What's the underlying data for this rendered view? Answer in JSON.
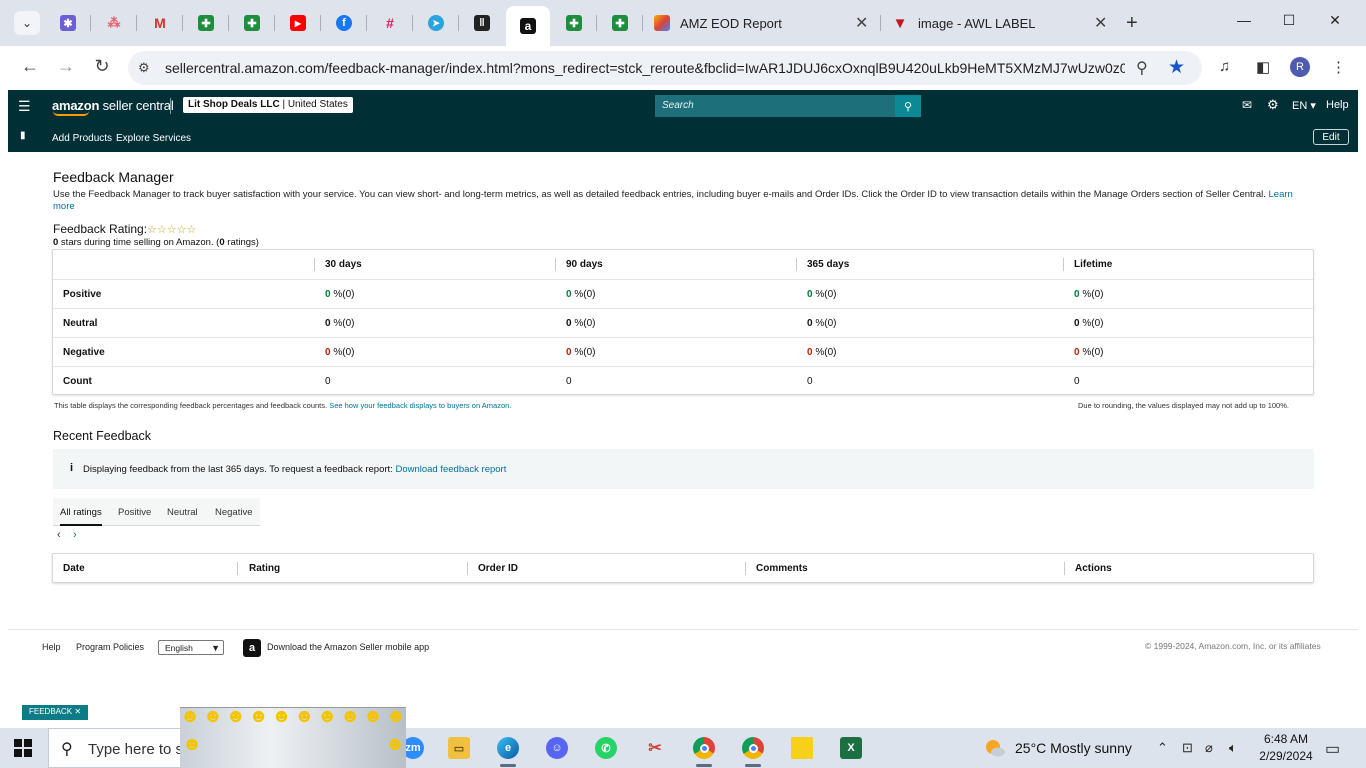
{
  "browser": {
    "tabs": [
      {
        "name": "amz-eod-report",
        "title": "AMZ EOD Report"
      },
      {
        "name": "awl-label",
        "title": "image - AWL LABEL"
      }
    ],
    "url_host": "sellercentral.amazon.com",
    "url_path": "/feedback-manager/index.html?mons_redirect=stck_reroute&fbclid=IwAR1JDUJ6cxOxnqlB9U420uLkb9HeMT5XMzMJ7wUzw0z0...",
    "profile_initial": "R"
  },
  "sc_header": {
    "logo_text_bold": "amazon",
    "logo_text": " seller central",
    "store_name": "Lit Shop Deals LLC",
    "store_region": " | United States",
    "search_placeholder": "Search",
    "language": "EN",
    "help": "Help"
  },
  "subnav": {
    "add_products": "Add Products",
    "explore_services": "Explore Services",
    "edit": "Edit"
  },
  "page": {
    "title": "Feedback Manager",
    "description": "Use the Feedback Manager to track buyer satisfaction with your service. You can view short- and long-term metrics, as well as detailed feedback entries, including buyer e-mails and Order IDs. Click the Order ID to view transaction details within the Manage Orders section of Seller Central.",
    "learn_more": "Learn more",
    "rating_title": "Feedback Rating:",
    "stars": "☆☆☆☆☆",
    "rating_stars_count": "0",
    "rating_sub_mid": " stars during time selling on Amazon. (",
    "rating_count": "0",
    "rating_sub_end": " ratings)"
  },
  "metrics": {
    "columns": [
      "30 days",
      "90 days",
      "365 days",
      "Lifetime"
    ],
    "rows": [
      {
        "label": "Positive",
        "cells": [
          {
            "n": "0",
            "s": " %(0)"
          },
          {
            "n": "0",
            "s": " %(0)"
          },
          {
            "n": "0",
            "s": " %(0)"
          },
          {
            "n": "0",
            "s": " %(0)"
          }
        ]
      },
      {
        "label": "Neutral",
        "cells": [
          {
            "n": "0",
            "s": " %(0)"
          },
          {
            "n": "0",
            "s": " %(0)"
          },
          {
            "n": "0",
            "s": " %(0)"
          },
          {
            "n": "0",
            "s": " %(0)"
          }
        ]
      },
      {
        "label": "Negative",
        "cells": [
          {
            "n": "0",
            "s": " %(0)"
          },
          {
            "n": "0",
            "s": " %(0)"
          },
          {
            "n": "0",
            "s": " %(0)"
          },
          {
            "n": "0",
            "s": " %(0)"
          }
        ]
      },
      {
        "label": "Count",
        "cells": [
          "0",
          "0",
          "0",
          "0"
        ]
      }
    ],
    "note_left": "This table displays the corresponding feedback percentages and feedback counts.",
    "note_left_link": "See how your feedback displays to buyers on Amazon.",
    "note_right": "Due to rounding, the values displayed may not add up to 100%."
  },
  "recent": {
    "title": "Recent Feedback",
    "info_icon": "i",
    "info_text": "Displaying feedback from the last 365 days. To request a feedback report: ",
    "info_link": "Download feedback report",
    "tabs": [
      "All ratings",
      "Positive",
      "Neutral",
      "Negative"
    ],
    "pager_prev": "‹",
    "pager_next": "›",
    "table_columns": [
      "Date",
      "Rating",
      "Order ID",
      "Comments",
      "Actions"
    ]
  },
  "footer": {
    "help": "Help",
    "program_policies": "Program Policies",
    "language_selected": "English",
    "app_link": "Download the Amazon Seller mobile app",
    "copyright": "© 1999-2024, Amazon.com, Inc. or its affiliates",
    "feedback_chip": "FEEDBACK ✕"
  },
  "taskbar": {
    "search_text": "Type here to s",
    "weather": "25°C  Mostly sunny",
    "time": "6:48 AM",
    "date": "2/29/2024"
  }
}
